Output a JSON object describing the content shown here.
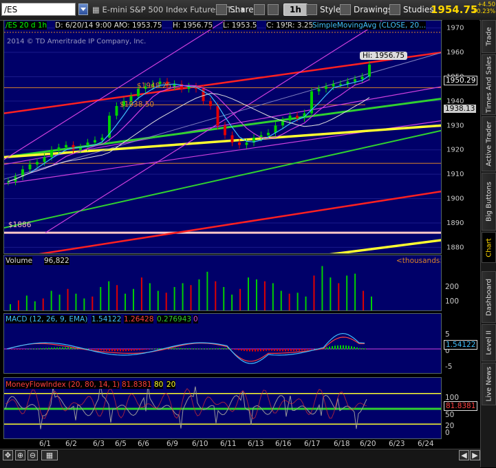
{
  "toolbar": {
    "symbol": "/ES",
    "description": "E-mini S&P 500 Index Futures,ET...",
    "share": "Share",
    "timeframe": "1h",
    "style": "Style",
    "drawings": "Drawings",
    "studies": "Studies",
    "last_price": "1954.75",
    "change": "+4.50",
    "change_pct": "+0.23%"
  },
  "sidebar": [
    "Trade",
    "Times And Sales",
    "Active Trader",
    "Big Buttons",
    "Chart",
    "Dashboard",
    "Level II",
    "Live News"
  ],
  "sidebar_active": "Chart",
  "price_pane": {
    "header": {
      "series": "/ES 20 d 1h",
      "date": "D: 6/20/14 9:00 AM",
      "open": "O: 1953.75",
      "high": "H: 1956.75",
      "low": "L: 1953.5",
      "close": "C: 1954.75",
      "range": "R: 3.25",
      "study": "SimpleMovingAvg (CLOSE, 20..."
    },
    "copyright": "2014 © TD Ameritrade IP Company, Inc.",
    "callout_hi": "Hi: 1956.75",
    "labels": [
      "$1948.25",
      "$1938.50",
      "$1886"
    ],
    "axis_boxes": [
      "1950.29",
      "1938.13"
    ],
    "yticks": [
      1970,
      1960,
      1950,
      1940,
      1930,
      1920,
      1910,
      1900,
      1890,
      1880
    ]
  },
  "volume_pane": {
    "label": "Volume",
    "value": "96,822",
    "unit": "<thousands>",
    "yticks": [
      "200",
      "100"
    ]
  },
  "macd_pane": {
    "label": "MACD (12, 26, 9, EMA)",
    "v1": "1.54122",
    "v2": "1.26428",
    "v3": "0.276943",
    "v4": "0",
    "axis_box": "1.54122",
    "yticks": [
      "5",
      "0",
      "-5"
    ]
  },
  "mfi_pane": {
    "label": "MoneyFlowIndex (20, 80, 14, 1)",
    "v1": "81.8381",
    "v2": "80",
    "v3": "20",
    "axis_box": "81.8381",
    "yticks": [
      "100",
      "80",
      "50",
      "20",
      "0"
    ]
  },
  "xaxis": [
    "6/1",
    "6/2",
    "6/3",
    "6/5",
    "6/6",
    "6/9",
    "6/10",
    "6/11",
    "6/13",
    "6/16",
    "6/17",
    "6/18",
    "6/20",
    "6/23",
    "6/24"
  ],
  "colors": {
    "pane_bg": "#000069",
    "price_up": "#00d000",
    "price_down": "#e00000",
    "yellow": "#ffff30",
    "green": "#30d030",
    "red": "#ff2020",
    "magenta": "#d040e0",
    "cyan": "#40c0ff",
    "orange": "#d9822b",
    "gold": "#ffd700"
  },
  "chart_data": {
    "type": "line",
    "title": "/ES 20 d 1h",
    "ylim": [
      1877,
      1973
    ],
    "x_categories": [
      "6/1",
      "6/2",
      "6/3",
      "6/5",
      "6/6",
      "6/9",
      "6/10",
      "6/11",
      "6/13",
      "6/16",
      "6/17",
      "6/18",
      "6/20",
      "6/23",
      "6/24"
    ],
    "close_series": [
      1907,
      1909,
      1912,
      1914,
      1915,
      1917,
      1920,
      1921,
      1922,
      1920,
      1921,
      1923,
      1924,
      1925,
      1934,
      1938,
      1940,
      1942,
      1945,
      1946,
      1947,
      1948,
      1946,
      1947,
      1945,
      1946,
      1945,
      1940,
      1938,
      1930,
      1926,
      1923,
      1922,
      1923,
      1925,
      1926,
      1927,
      1930,
      1932,
      1934,
      1933,
      1935,
      1944,
      1945,
      1946,
      1947,
      1947,
      1948,
      1949,
      1950,
      1955
    ],
    "horizontal_levels": [
      {
        "value": 1948.25,
        "label": "$1948.25"
      },
      {
        "value": 1938.5,
        "label": "$1938.50"
      },
      {
        "value": 1886,
        "label": "$1886"
      },
      {
        "value": 1945.5
      },
      {
        "value": 1914.5
      }
    ],
    "volume_thousands": [
      40,
      60,
      85,
      55,
      70,
      110,
      90,
      120,
      95,
      70,
      80,
      130,
      160,
      140,
      95,
      120,
      180,
      150,
      110,
      100,
      130,
      150,
      140,
      170,
      210,
      160,
      130,
      90,
      120,
      180,
      170,
      160,
      150,
      110,
      95,
      100,
      80,
      190,
      240,
      180,
      150,
      190,
      200,
      110,
      80
    ],
    "macd": {
      "value": 1.54122,
      "signal": 1.26428,
      "hist": 0.276943,
      "ylim": [
        -7,
        7
      ]
    },
    "mfi": {
      "value": 81.8381,
      "upper": 80,
      "lower": 20,
      "ylim": [
        0,
        100
      ]
    }
  }
}
